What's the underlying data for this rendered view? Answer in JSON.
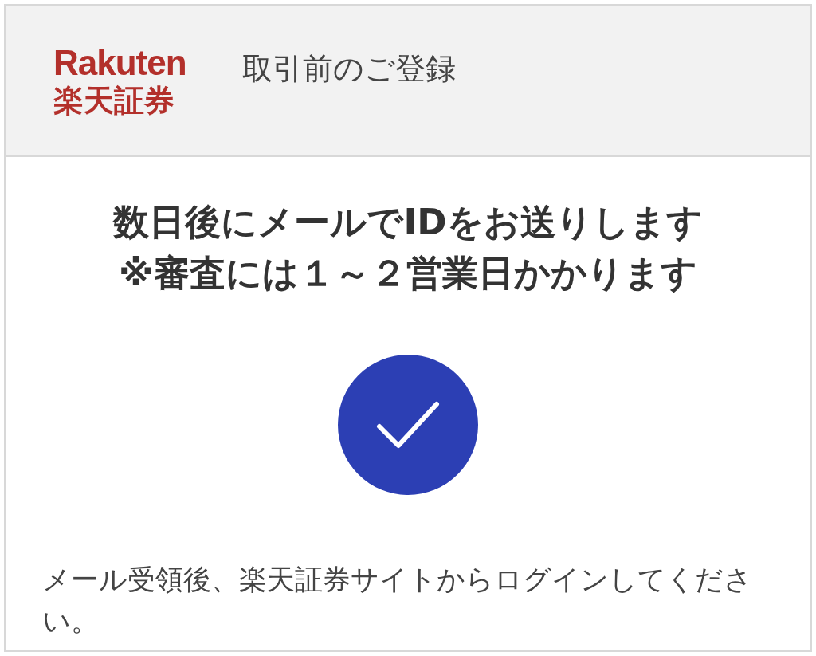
{
  "header": {
    "logo_latin": "Rakuten",
    "logo_japanese": "楽天証券",
    "title": "取引前のご登録"
  },
  "heading_lines": [
    "数日後にメールでIDをお送りします",
    "※審査には１～２営業日かかります"
  ],
  "status": {
    "kind": "complete"
  },
  "message": "メール受領後、楽天証券サイトからログインしてください。"
}
